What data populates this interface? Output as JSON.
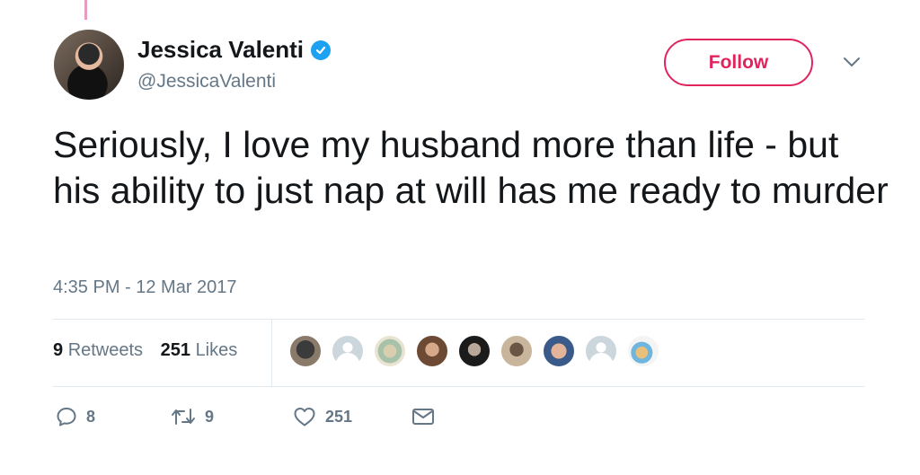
{
  "tweet": {
    "author_name": "Jessica Valenti",
    "author_handle": "@JessicaValenti",
    "follow_label": "Follow",
    "text": "Seriously, I love my husband more than life - but his ability to just nap at will has me ready to murder",
    "timestamp": "4:35 PM - 12 Mar 2017",
    "retweet_count": "9",
    "retweet_label": "Retweets",
    "like_count": "251",
    "like_label": "Likes"
  },
  "actions": {
    "reply_count": "8",
    "retweet_count": "9",
    "like_count": "251"
  },
  "icons": {
    "verified": "verified-badge-icon",
    "caret": "chevron-down-icon",
    "reply": "reply-icon",
    "retweet": "retweet-icon",
    "like": "heart-icon",
    "dm": "envelope-icon"
  },
  "colors": {
    "accent": "#e0245e",
    "verified": "#1da1f2",
    "text_primary": "#14171a",
    "text_secondary": "#657786",
    "divider": "#e1e8ed"
  }
}
